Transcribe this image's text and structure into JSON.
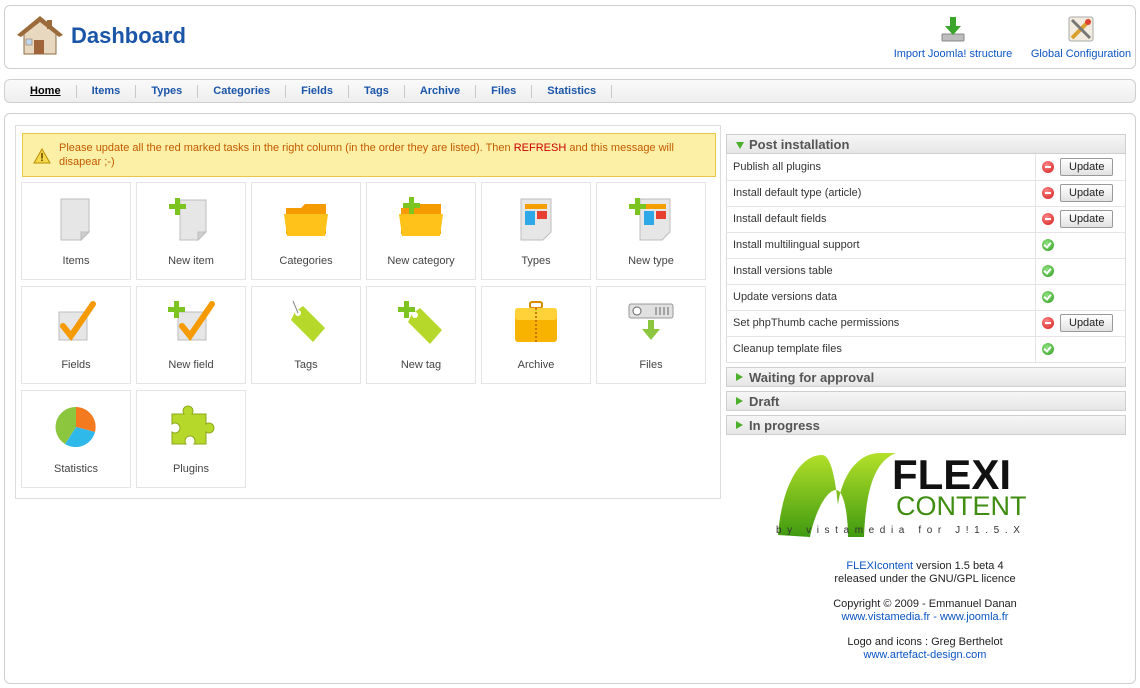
{
  "header": {
    "title": "Dashboard",
    "tools": [
      {
        "label": "Import Joomla! structure",
        "icon": "download-icon"
      },
      {
        "label": "Global Configuration",
        "icon": "tools-icon"
      }
    ]
  },
  "nav": {
    "items": [
      "Home",
      "Items",
      "Types",
      "Categories",
      "Fields",
      "Tags",
      "Archive",
      "Files",
      "Statistics"
    ],
    "active": "Home"
  },
  "warning": {
    "before": "Please update all the red marked tasks in the right column (in the order they are listed). Then ",
    "highlight": "REFRESH",
    "after": " and this message will disapear ;-)"
  },
  "tiles": [
    {
      "label": "Items",
      "icon": "items-icon"
    },
    {
      "label": "New item",
      "icon": "new-item-icon"
    },
    {
      "label": "Categories",
      "icon": "folder-icon"
    },
    {
      "label": "New category",
      "icon": "new-folder-icon"
    },
    {
      "label": "Types",
      "icon": "types-icon"
    },
    {
      "label": "New type",
      "icon": "new-type-icon"
    },
    {
      "label": "Fields",
      "icon": "checkmark-icon"
    },
    {
      "label": "New field",
      "icon": "new-checkmark-icon"
    },
    {
      "label": "Tags",
      "icon": "tag-icon"
    },
    {
      "label": "New tag",
      "icon": "new-tag-icon"
    },
    {
      "label": "Archive",
      "icon": "archive-icon"
    },
    {
      "label": "Files",
      "icon": "files-icon"
    },
    {
      "label": "Statistics",
      "icon": "pie-chart-icon"
    },
    {
      "label": "Plugins",
      "icon": "puzzle-icon"
    }
  ],
  "panels": {
    "post_installation": {
      "title": "Post installation",
      "expanded": true,
      "tasks": [
        {
          "label": "Publish all plugins",
          "status": "red",
          "button": "Update"
        },
        {
          "label": "Install default type (article)",
          "status": "red",
          "button": "Update"
        },
        {
          "label": "Install default fields",
          "status": "red",
          "button": "Update"
        },
        {
          "label": "Install multilingual support",
          "status": "green",
          "button": ""
        },
        {
          "label": "Install versions table",
          "status": "green",
          "button": ""
        },
        {
          "label": "Update versions data",
          "status": "green",
          "button": ""
        },
        {
          "label": "Set phpThumb cache permissions",
          "status": "red",
          "button": "Update"
        },
        {
          "label": "Cleanup template files",
          "status": "green",
          "button": ""
        }
      ]
    },
    "collapsed": [
      {
        "title": "Waiting for approval"
      },
      {
        "title": "Draft"
      },
      {
        "title": "In progress"
      }
    ]
  },
  "logo": {
    "line1": "FLEXI",
    "line2": "CONTENT",
    "tagline": "by vistamedia for J!1.5.X"
  },
  "credits": {
    "product_link": "FLEXIcontent",
    "version": " version 1.5 beta 4",
    "licence": "released under the GNU/GPL licence",
    "copyright": "Copyright © 2009 - Emmanuel Danan",
    "link_vistamedia": "www.vistamedia.fr",
    "separator": " - ",
    "link_joomla": "www.joomla.fr",
    "logo_credit": "Logo and icons : Greg Berthelot",
    "link_artefact": "www.artefact-design.com"
  },
  "colors": {
    "accent": "#1a55a8",
    "link": "#0b55c4",
    "warning_bg": "#fbf0a6",
    "warning_text": "#c35a00",
    "status_red": "#d01818",
    "status_green": "#2f9e1e",
    "logo_green": "#6fbf1c"
  }
}
